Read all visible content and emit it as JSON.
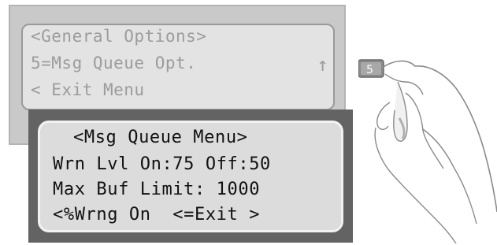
{
  "general_menu": {
    "title": "<General Options>",
    "item": "5=Msg Queue Opt.",
    "exit": "< Exit Menu",
    "arrow_icon": "up-arrow-icon"
  },
  "msg_queue_menu": {
    "title": "<Msg Queue Menu>",
    "line1": "Wrn Lvl On:75 Off:50",
    "line2": "Max Buf Limit: 1000",
    "line3": "<%Wrng On  <=Exit >"
  },
  "keypad": {
    "key_label": "5"
  },
  "colors": {
    "panel_front": "#636363",
    "panel_back": "#c9c9c9",
    "lcd_text": "#111111",
    "lcd_text_dim": "#9c9c9c"
  }
}
